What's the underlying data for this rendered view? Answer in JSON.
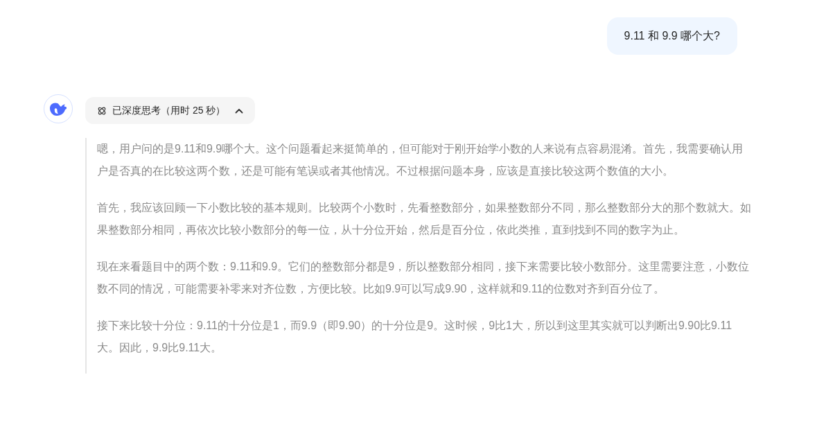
{
  "user_message": {
    "text": "9.11 和 9.9 哪个大?"
  },
  "reply": {
    "thinking_toggle": {
      "label": "已深度思考（用时 25 秒）",
      "expanded": true
    },
    "thinking_paragraphs": [
      "嗯，用户问的是9.11和9.9哪个大。这个问题看起来挺简单的，但可能对于刚开始学小数的人来说有点容易混淆。首先，我需要确认用户是否真的在比较这两个数，还是可能有笔误或者其他情况。不过根据问题本身，应该是直接比较这两个数值的大小。",
      "首先，我应该回顾一下小数比较的基本规则。比较两个小数时，先看整数部分，如果整数部分不同，那么整数部分大的那个数就大。如果整数部分相同，再依次比较小数部分的每一位，从十分位开始，然后是百分位，依此类推，直到找到不同的数字为止。",
      "现在来看题目中的两个数：9.11和9.9。它们的整数部分都是9，所以整数部分相同，接下来需要比较小数部分。这里需要注意，小数位数不同的情况，可能需要补零来对齐位数，方便比较。比如9.9可以写成9.90，这样就和9.11的位数对齐到百分位了。",
      "接下来比较十分位：9.11的十分位是1，而9.9（即9.90）的十分位是9。这时候，9比1大，所以到这里其实就可以判断出9.90比9.11大。因此，9.9比9.11大。"
    ]
  }
}
